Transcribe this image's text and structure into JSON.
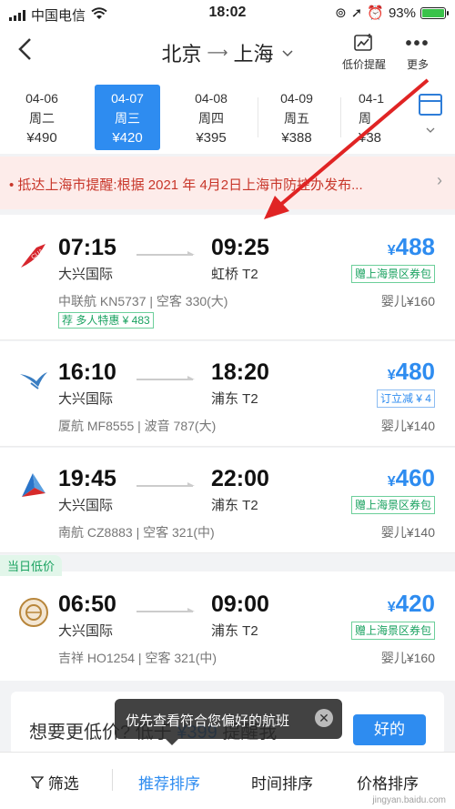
{
  "status": {
    "carrier": "中国电信",
    "time": "18:02",
    "battery": "93%"
  },
  "header": {
    "from": "北京",
    "to": "上海",
    "price_alert": "低价提醒",
    "more": "更多"
  },
  "dates": [
    {
      "date": "04-06",
      "weekday": "周二",
      "price": "¥490"
    },
    {
      "date": "04-07",
      "weekday": "周三",
      "price": "¥420",
      "active": true
    },
    {
      "date": "04-08",
      "weekday": "周四",
      "price": "¥395"
    },
    {
      "date": "04-09",
      "weekday": "周五",
      "price": "¥388"
    },
    {
      "date": "04-1",
      "weekday": "周",
      "price": "¥38"
    }
  ],
  "alert": "• 抵达上海市提醒:根据 2021 年 4月2日上海市防控办发布...",
  "flights": [
    {
      "dep": "07:15",
      "arr": "09:25",
      "dep_ap": "大兴国际",
      "arr_ap": "虹桥 T2",
      "price": "488",
      "promo": "赠上海景区券包",
      "meta": "中联航 KN5737 | 空客 330(大)",
      "baby": "婴儿¥160",
      "tag": "荐  多人特惠 ¥ 483"
    },
    {
      "dep": "16:10",
      "arr": "18:20",
      "dep_ap": "大兴国际",
      "arr_ap": "浦东 T2",
      "price": "480",
      "promo": "订立减 ¥ 4",
      "meta": "厦航 MF8555 | 波音 787(大)",
      "baby": "婴儿¥140"
    },
    {
      "dep": "19:45",
      "arr": "22:00",
      "dep_ap": "大兴国际",
      "arr_ap": "浦东 T2",
      "price": "460",
      "promo": "赠上海景区券包",
      "meta": "南航 CZ8883 | 空客 321(中)",
      "baby": "婴儿¥140"
    },
    {
      "dep": "06:50",
      "arr": "09:00",
      "dep_ap": "大兴国际",
      "arr_ap": "浦东 T2",
      "price": "420",
      "promo": "赠上海景区券包",
      "meta": "吉祥 HO1254 | 空客 321(中)",
      "baby": "婴儿¥160",
      "lowtag": "当日低价"
    }
  ],
  "reminder": {
    "text": "想要更低价? 低于",
    "price": "¥399",
    "suffix": "提醒我",
    "ok": "好的"
  },
  "toast": "优先查看符合您偏好的航班",
  "bottom": {
    "filter": "筛选",
    "recommend": "推荐排序",
    "time": "时间排序",
    "price": "价格排序"
  },
  "yen": "¥",
  "watermark": "jingyan.baidu.com"
}
